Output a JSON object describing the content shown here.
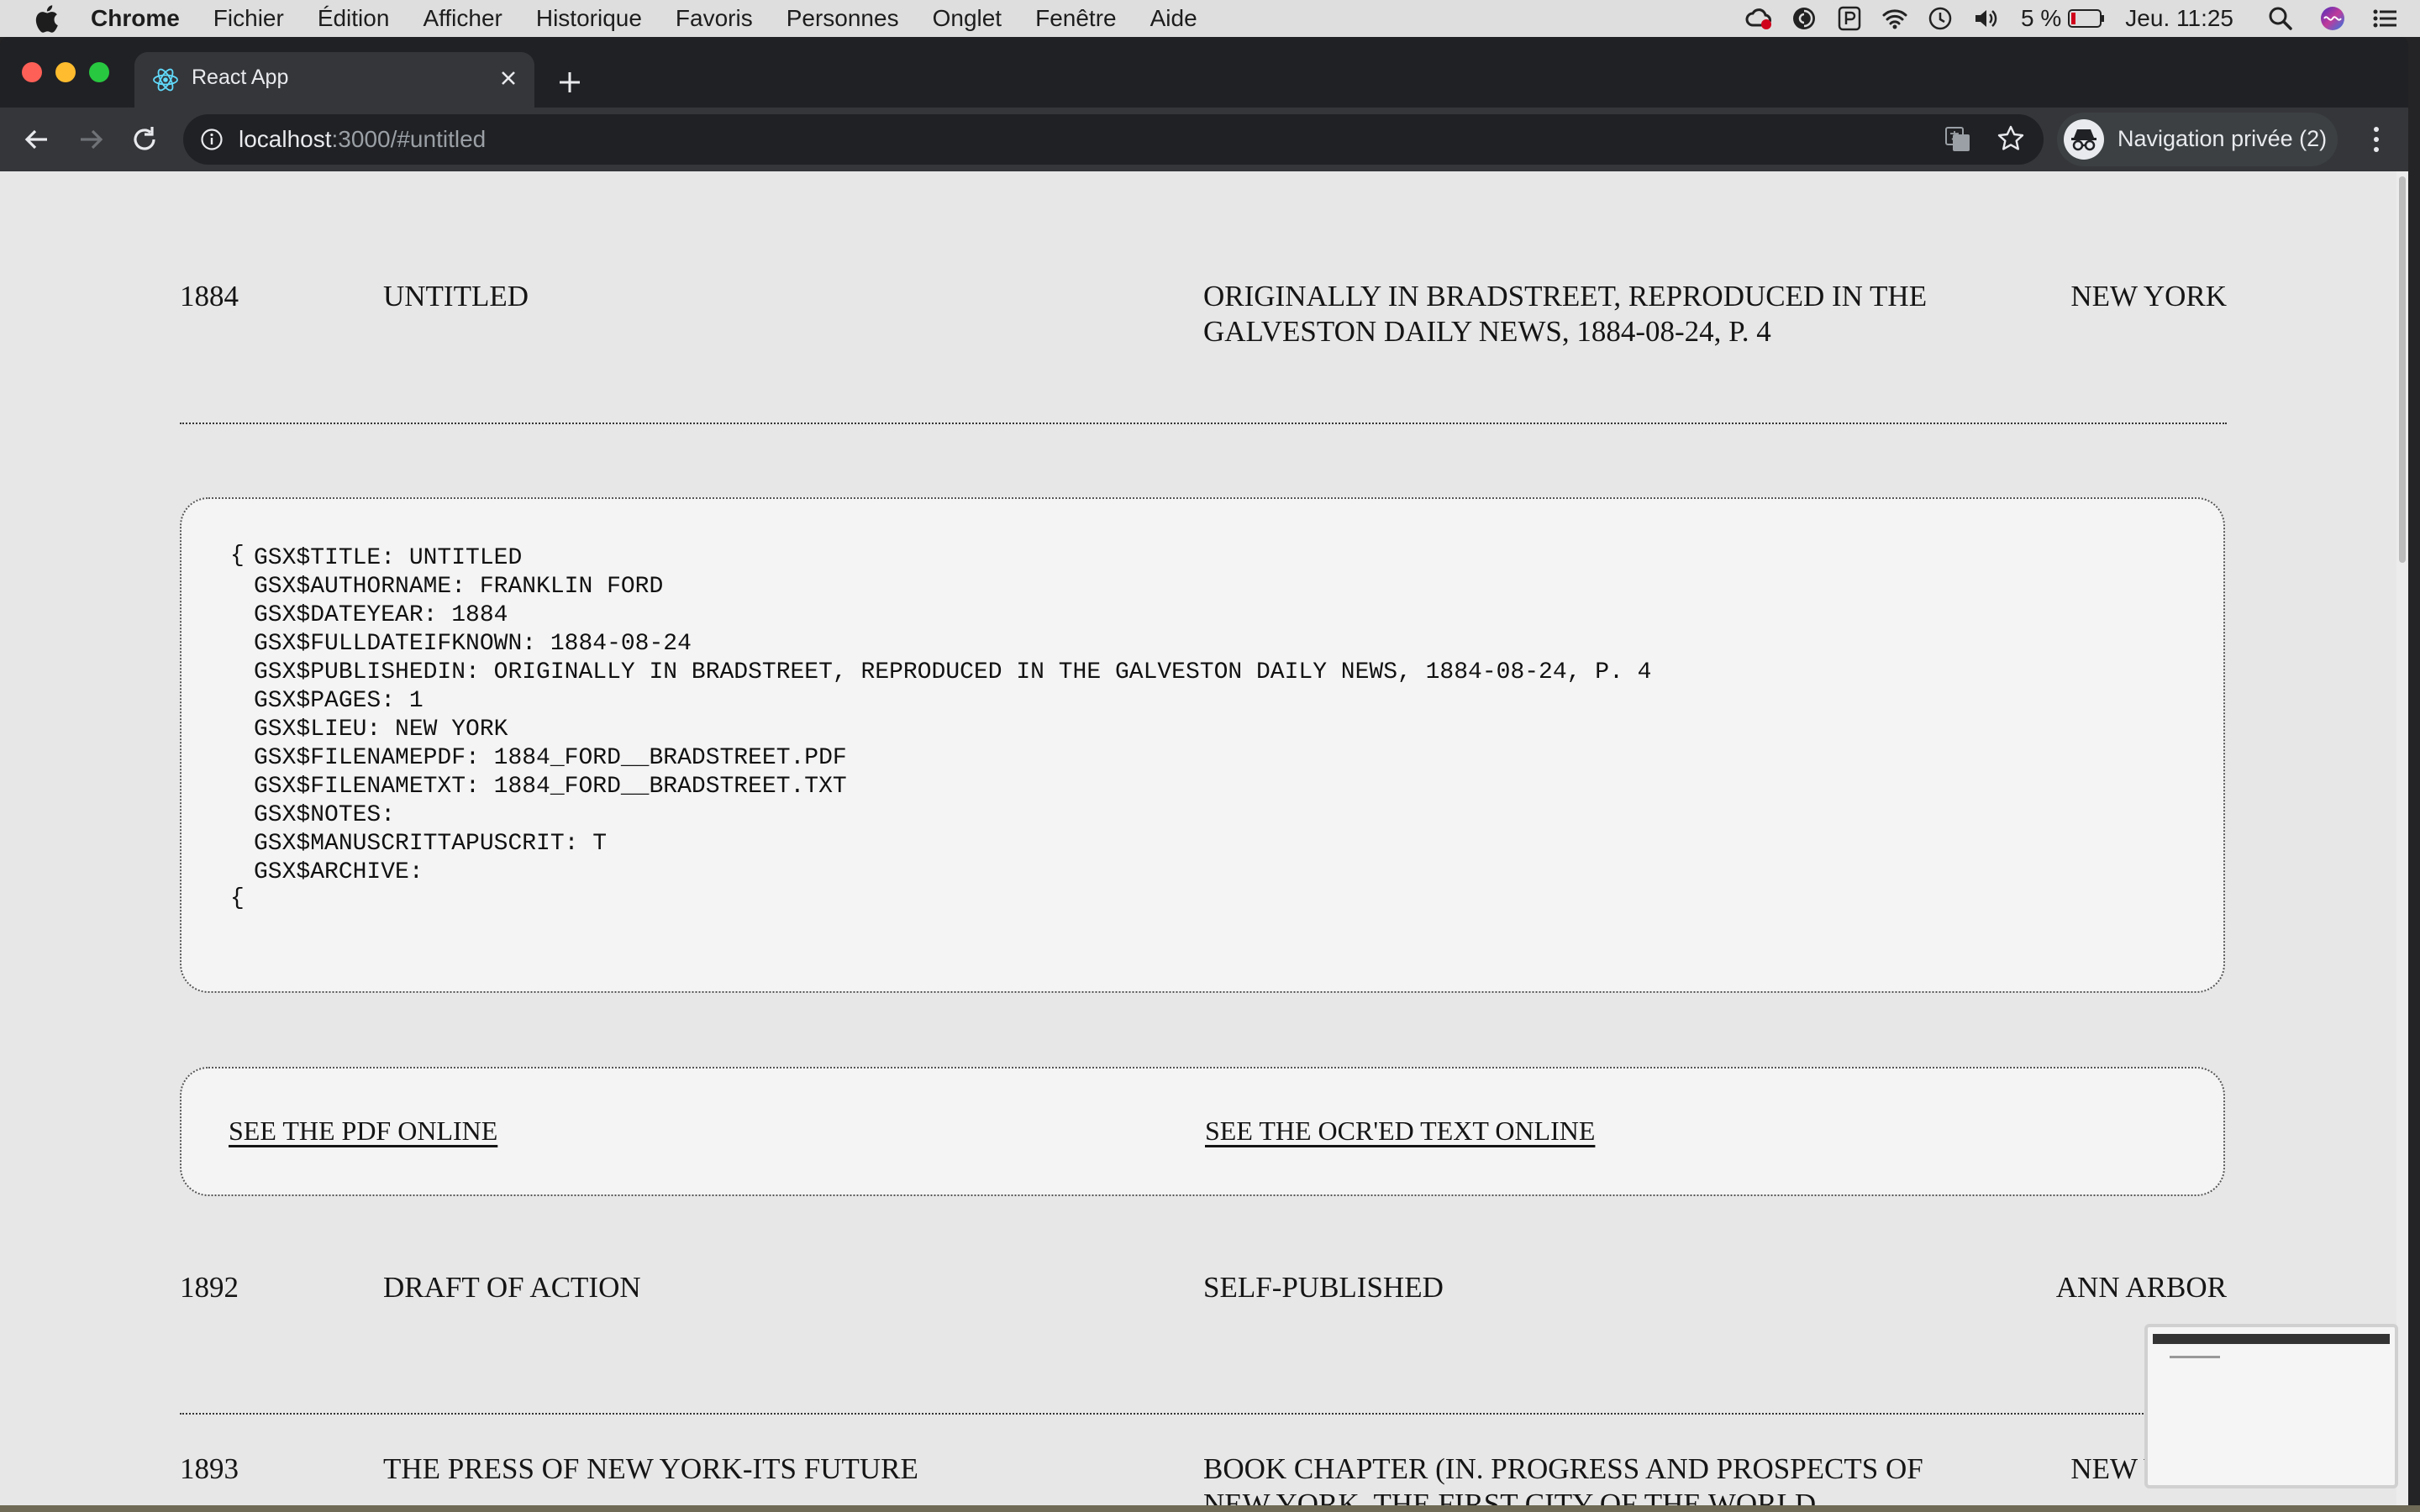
{
  "menubar": {
    "app": "Chrome",
    "items": [
      "Fichier",
      "Édition",
      "Afficher",
      "Historique",
      "Favoris",
      "Personnes",
      "Onglet",
      "Fenêtre",
      "Aide"
    ],
    "battery": "5 %",
    "clock": "Jeu. 11:25"
  },
  "browser": {
    "tab_title": "React App",
    "url_host": "localhost",
    "url_rest": ":3000/#untitled",
    "incognito_label": "Navigation privée (2)"
  },
  "entries": [
    {
      "year": "1884",
      "title": "UNTITLED",
      "published_in": "ORIGINALLY IN BRADSTREET, REPRODUCED IN THE GALVESTON DAILY NEWS, 1884-08-24, P. 4",
      "place": "NEW YORK"
    },
    {
      "year": "1892",
      "title": "DRAFT OF ACTION",
      "published_in": "SELF-PUBLISHED",
      "place": "ANN ARBOR"
    },
    {
      "year": "1893",
      "title": "THE PRESS OF NEW YORK-ITS FUTURE",
      "published_in": "BOOK CHAPTER (IN. PROGRESS AND PROSPECTS OF NEW YORK, THE FIRST CITY OF THE WORLD, COMMERCIAL TRAVELERS CLUB OF NEW YORK",
      "place": "NEW YORK"
    }
  ],
  "details": {
    "open_brace": "{",
    "close_brace": "{",
    "fields": [
      "GSX$TITLE: UNTITLED",
      "GSX$AUTHORNAME: FRANKLIN FORD",
      "GSX$DATEYEAR: 1884",
      "GSX$FULLDATEIFKNOWN: 1884-08-24",
      "GSX$PUBLISHEDIN: ORIGINALLY IN BRADSTREET, REPRODUCED IN THE GALVESTON DAILY NEWS, 1884-08-24, P. 4",
      "GSX$PAGES: 1",
      "GSX$LIEU: NEW YORK",
      "GSX$FILENAMEPDF: 1884_FORD__BRADSTREET.PDF",
      "GSX$FILENAMETXT: 1884_FORD__BRADSTREET.TXT",
      "GSX$NOTES:",
      "GSX$MANUSCRITTAPUSCRIT: T",
      "GSX$ARCHIVE:"
    ]
  },
  "links": {
    "pdf": "SEE THE PDF ONLINE",
    "ocr": "SEE THE OCR'ED TEXT ONLINE"
  }
}
